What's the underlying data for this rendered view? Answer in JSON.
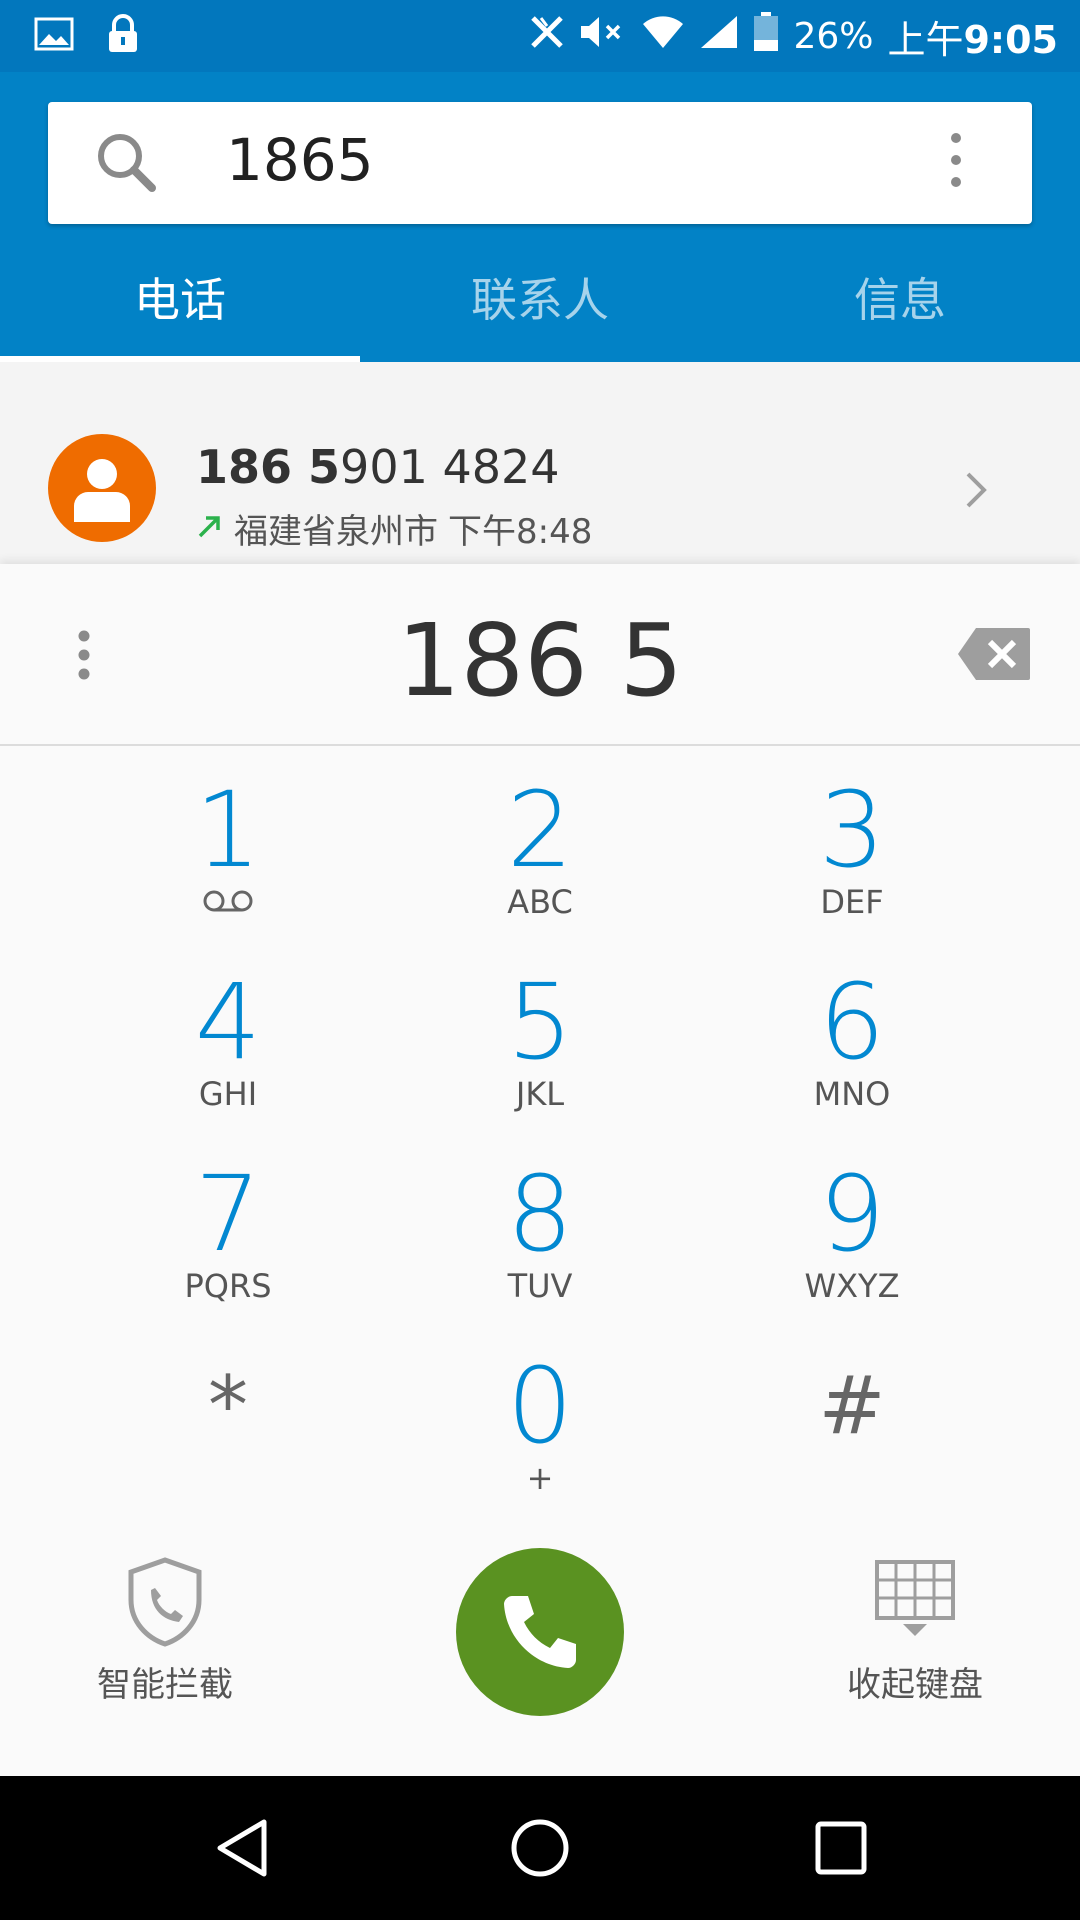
{
  "status_bar": {
    "battery": "26%",
    "time_prefix": "上午",
    "time": "9:05",
    "icons": [
      "image-icon",
      "lock-icon",
      "no-data-icon",
      "mute-icon",
      "wifi-icon",
      "signal-icon",
      "battery-icon"
    ]
  },
  "search": {
    "query": "1865"
  },
  "tabs": [
    {
      "label": "电话",
      "active": true
    },
    {
      "label": "联系人",
      "active": false
    },
    {
      "label": "信息",
      "active": false
    }
  ],
  "result": {
    "number_match": "186 5",
    "number_rest": "901 4824",
    "location": "福建省泉州市",
    "time": "下午8:48",
    "call_type": "outgoing"
  },
  "dialer": {
    "digits": "186 5",
    "keys": [
      {
        "digit": "1",
        "letters": ""
      },
      {
        "digit": "2",
        "letters": "ABC"
      },
      {
        "digit": "3",
        "letters": "DEF"
      },
      {
        "digit": "4",
        "letters": "GHI"
      },
      {
        "digit": "5",
        "letters": "JKL"
      },
      {
        "digit": "6",
        "letters": "MNO"
      },
      {
        "digit": "7",
        "letters": "PQRS"
      },
      {
        "digit": "8",
        "letters": "TUV"
      },
      {
        "digit": "9",
        "letters": "WXYZ"
      },
      {
        "digit": "*",
        "letters": ""
      },
      {
        "digit": "0",
        "letters": "+"
      },
      {
        "digit": "#",
        "letters": ""
      }
    ]
  },
  "actions": {
    "block_label": "智能拦截",
    "hide_keypad_label": "收起键盘"
  },
  "colors": {
    "header": "#0282c6",
    "status_bar": "#0277bd",
    "accent_digit": "#0288d1",
    "call_button": "#5a9221",
    "avatar": "#ef6c00"
  }
}
